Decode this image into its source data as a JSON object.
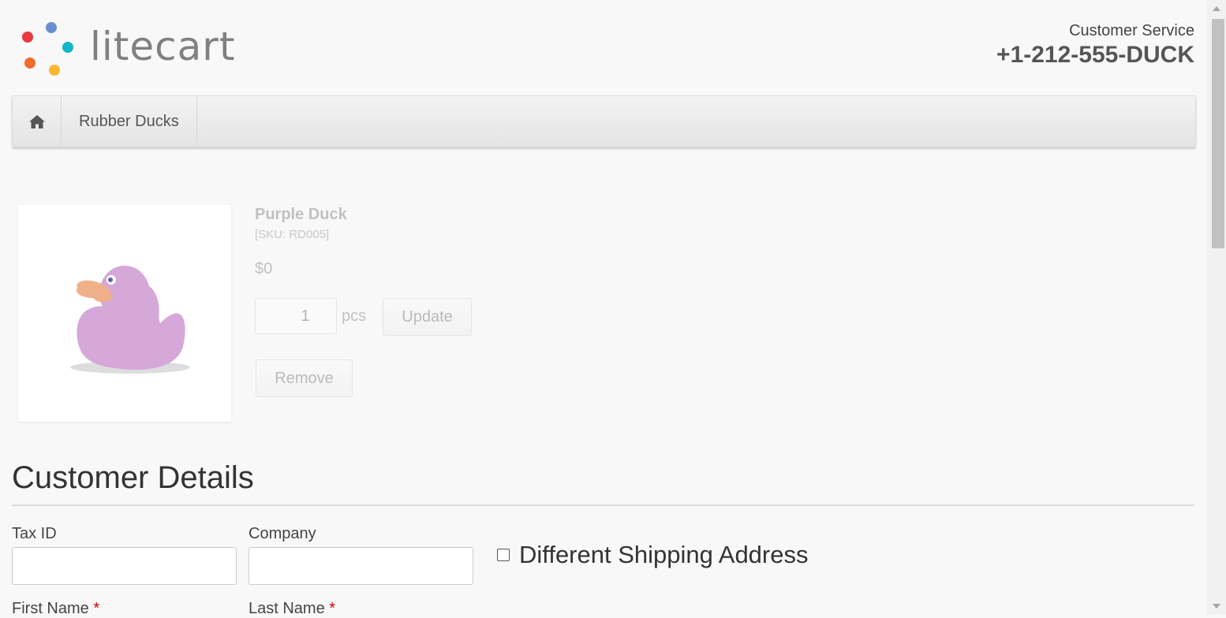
{
  "brand": {
    "logo_text": "litecart",
    "dot_colors": [
      "#e9383f",
      "#6a8fd0",
      "#12b4c8",
      "#f26b2f",
      "#f7b731"
    ]
  },
  "header": {
    "customer_service_label": "Customer Service",
    "phone": "+1-212-555-DUCK"
  },
  "nav": {
    "home_icon": "home-icon",
    "items": [
      {
        "label": "Rubber Ducks"
      }
    ]
  },
  "cart_item": {
    "name": "Purple Duck",
    "sku": "[SKU: RD005]",
    "price": "$0",
    "quantity": "1",
    "unit": "pcs",
    "update_label": "Update",
    "remove_label": "Remove",
    "image_icon": "rubber-duck-image"
  },
  "customer_details": {
    "title": "Customer Details",
    "fields": {
      "tax_id": {
        "label": "Tax ID",
        "value": ""
      },
      "company": {
        "label": "Company",
        "value": ""
      },
      "first_name": {
        "label": "First Name",
        "required": "*"
      },
      "last_name": {
        "label": "Last Name",
        "required": "*"
      }
    },
    "different_shipping_label": "Different Shipping Address"
  }
}
